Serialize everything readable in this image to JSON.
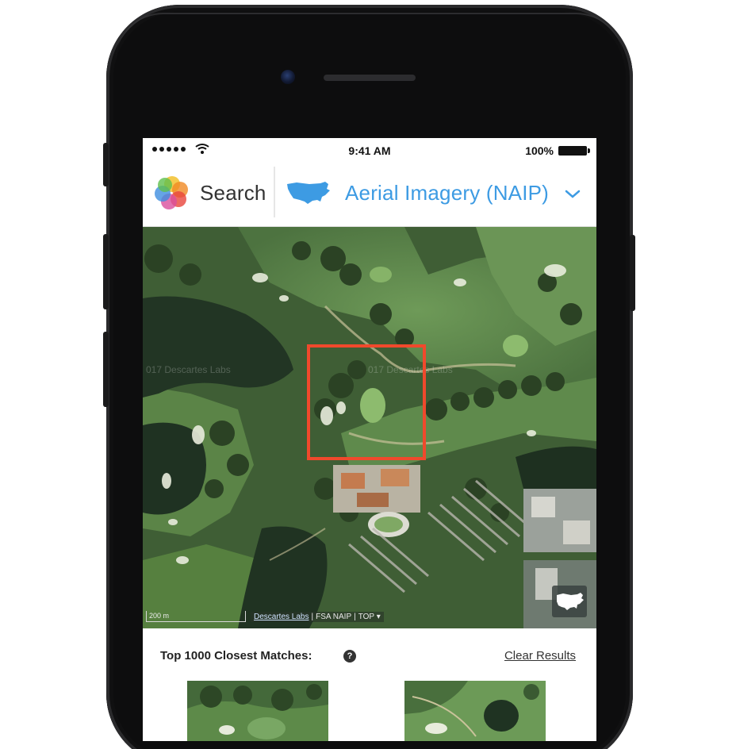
{
  "status_bar": {
    "time": "9:41 AM",
    "battery_percent": "100%",
    "signal_bars": 5,
    "icons": [
      "signal-dots-icon",
      "wifi-icon",
      "battery-icon"
    ]
  },
  "header": {
    "search_label": "Search",
    "layer_title": "Aerial Imagery (NAIP)",
    "logo_icon": "multicolor-petal-logo-icon",
    "layer_icon": "usa-map-icon",
    "dropdown_icon": "chevron-down-icon",
    "accent_color": "#3d9be3"
  },
  "map": {
    "watermark_left": "017 Descartes Labs",
    "watermark_mid": "017 Descartes Labs",
    "scale_label": "200 m",
    "attribution": {
      "provider": "Descartes Labs",
      "source": "FSA NAIP",
      "layer_option": "TOP ▾"
    },
    "selection_color": "#f0492c",
    "corner_button_icon": "usa-map-icon"
  },
  "results": {
    "title": "Top 1000 Closest Matches:",
    "info_icon": "?",
    "clear_label": "Clear Results"
  }
}
